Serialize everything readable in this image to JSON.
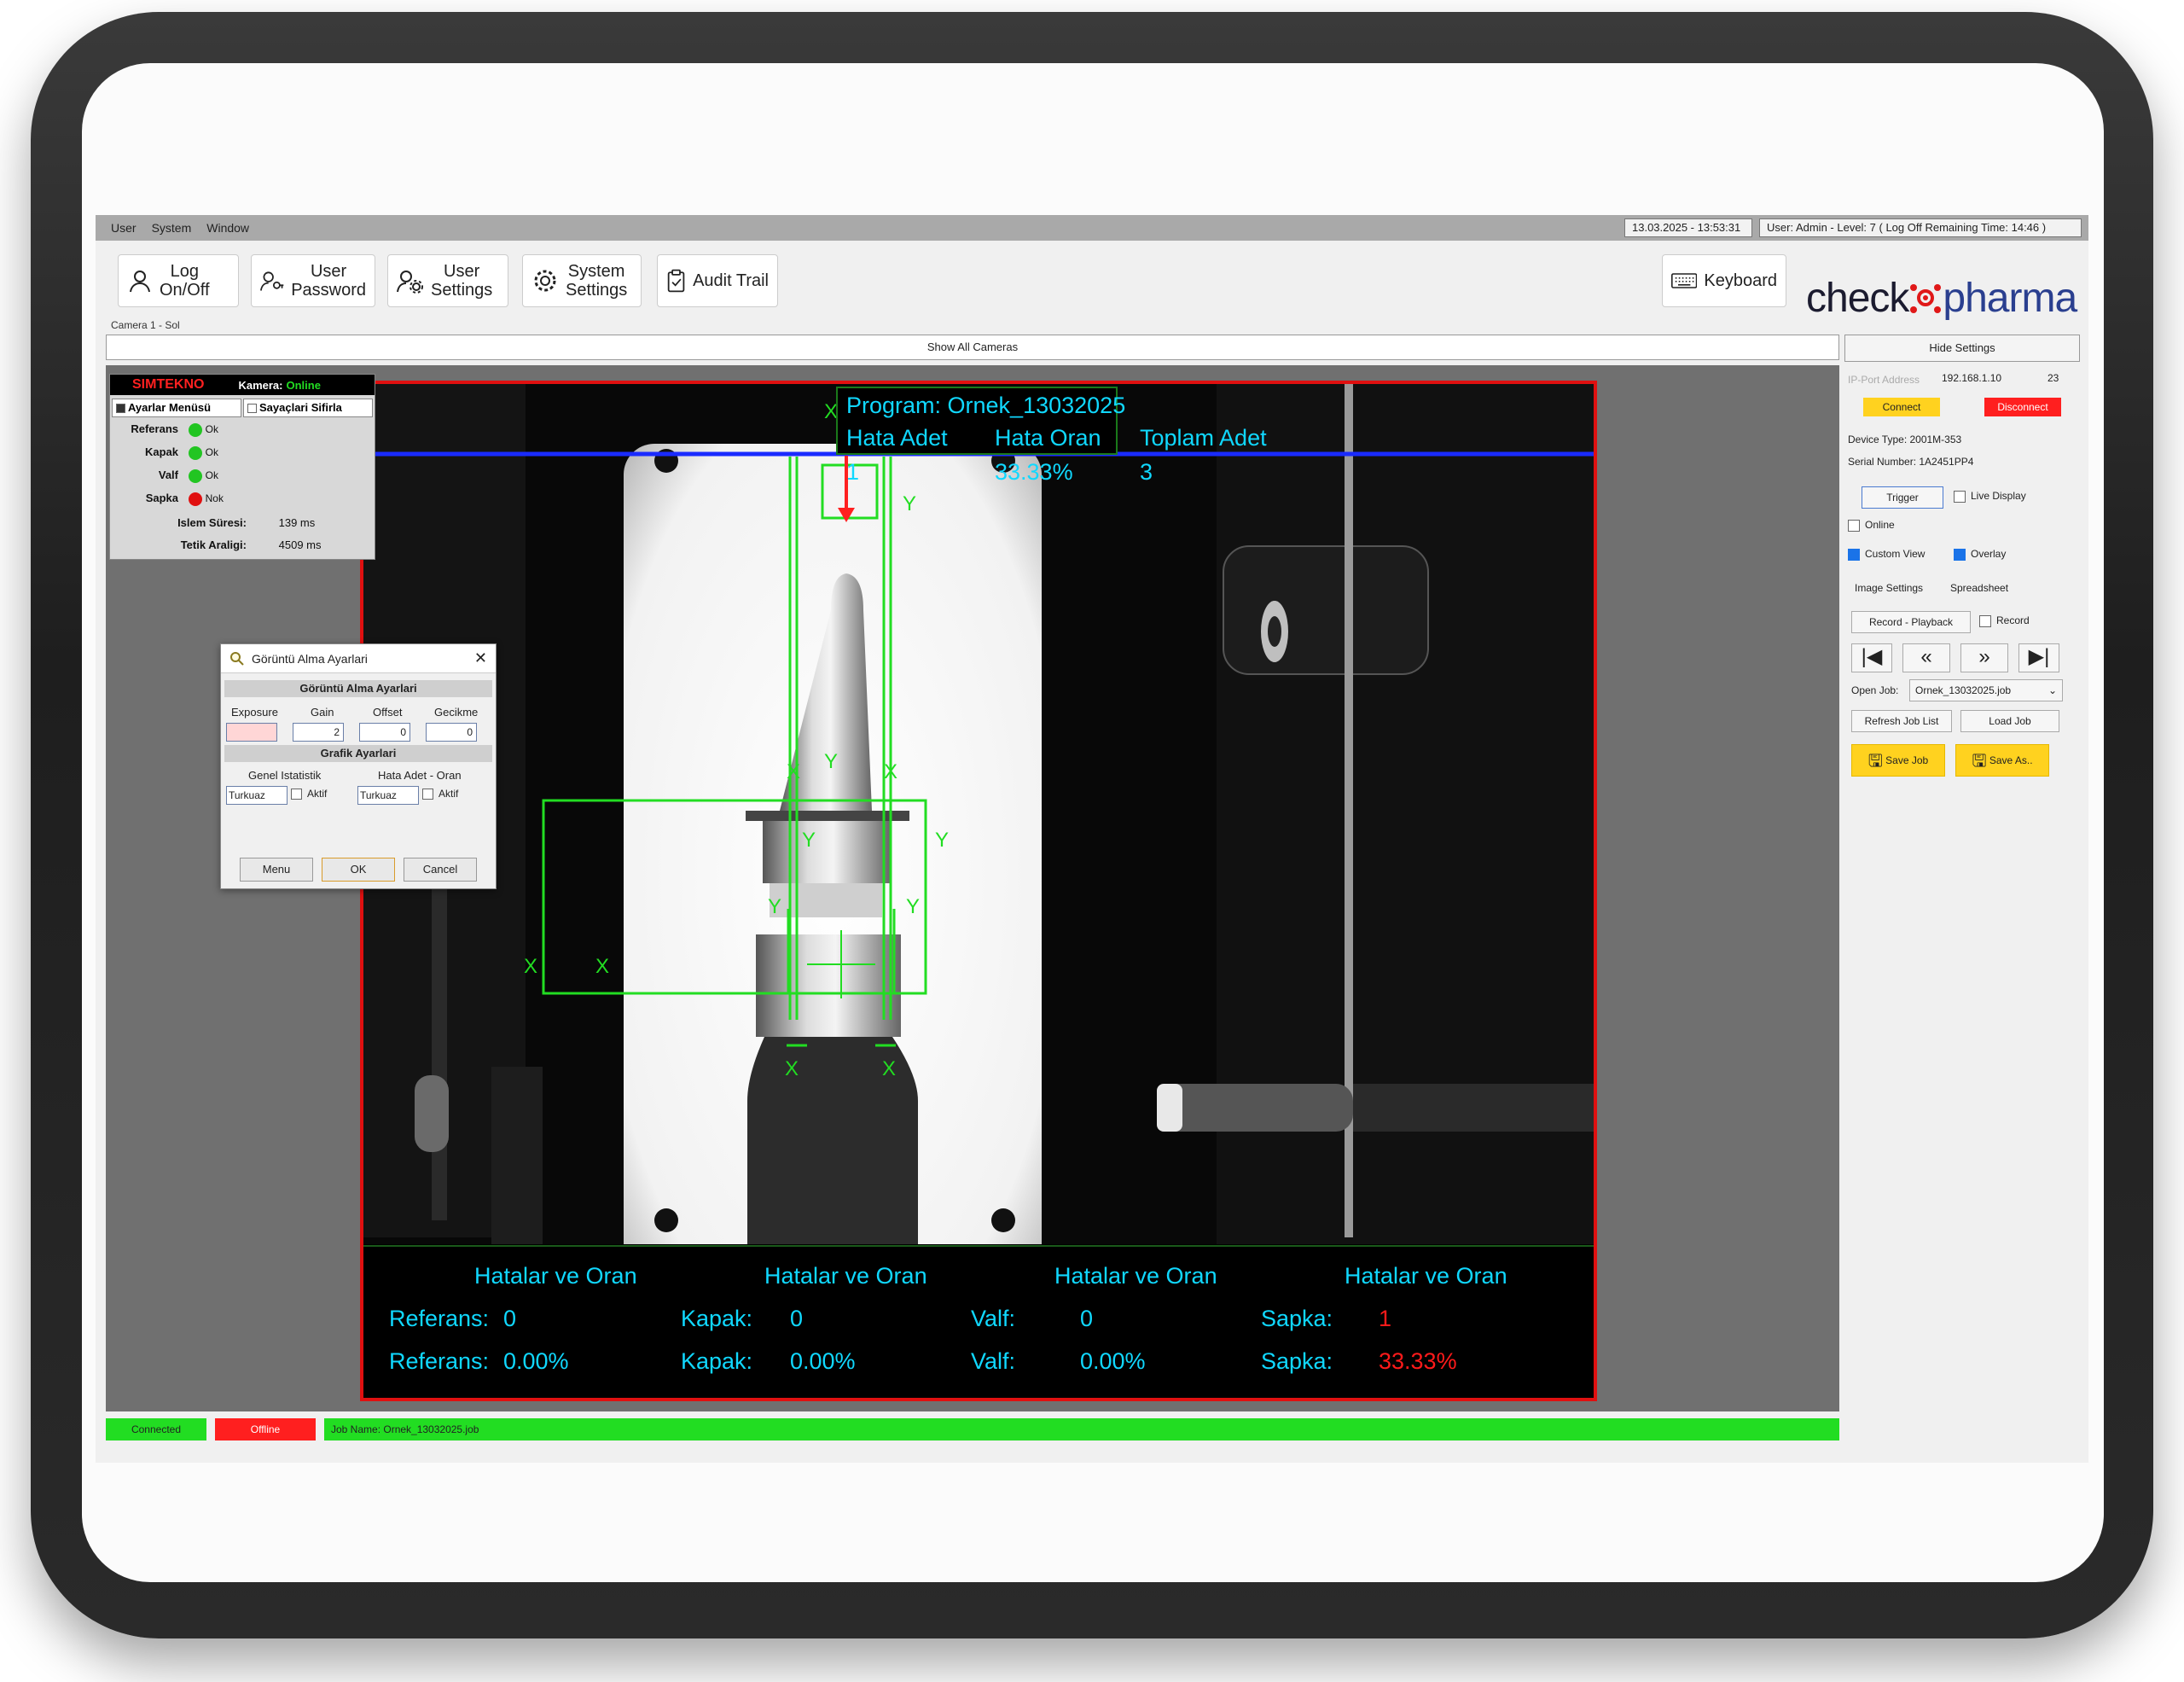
{
  "menu": [
    "User",
    "System",
    "Window"
  ],
  "datetime": "13.03.2025 - 13:53:31",
  "user_status": "User: Admin - Level: 7   ( Log Off Remaining Time: 14:46 )",
  "toolbar": {
    "log_onoff": "Log\nOn/Off",
    "user_password": "User\nPassword",
    "user_settings": "User\nSettings",
    "system_settings": "System\nSettings",
    "audit_trail": "Audit Trail",
    "keyboard": "Keyboard"
  },
  "logo": {
    "part1": "check",
    "part2": "pharma"
  },
  "camera_label": "Camera 1 - Sol",
  "show_all": "Show All Cameras",
  "hide_settings": "Hide Settings",
  "sim": {
    "brand": "SIMTEKNO",
    "camera_label": "Kamera:",
    "camera_status": "Online",
    "menu_btn": "Ayarlar Menüsü",
    "reset_btn": "Sayaçlari Sifirla",
    "rows": [
      {
        "label": "Referans",
        "status": "Ok",
        "color": "#22c522"
      },
      {
        "label": "Kapak",
        "status": "Ok",
        "color": "#22c522"
      },
      {
        "label": "Valf",
        "status": "Ok",
        "color": "#22c522"
      },
      {
        "label": "Sapka",
        "status": "Nok",
        "color": "#e01010"
      }
    ],
    "process_label": "Islem Süresi:",
    "process_value": "139 ms",
    "trigger_label": "Tetik Araligi:",
    "trigger_value": "4509 ms"
  },
  "dialog": {
    "title": "Görüntü Alma Ayarlari",
    "section1": "Görüntü Alma Ayarlari",
    "cols": [
      "Exposure",
      "Gain",
      "Offset",
      "Gecikme"
    ],
    "gain": "2",
    "offset": "0",
    "delay": "0",
    "section2": "Grafik Ayarlari",
    "genel": "Genel Istatistik",
    "hata": "Hata Adet - Oran",
    "color1": "Turkuaz",
    "color2": "Turkuaz",
    "aktif": "Aktif",
    "btn_menu": "Menu",
    "btn_ok": "OK",
    "btn_cancel": "Cancel"
  },
  "overlay": {
    "program": "Program: Ornek_13032025",
    "hata_adet_label": "Hata Adet",
    "hata_oran_label": "Hata Oran",
    "toplam_label": "Toplam Adet",
    "hata_adet": "1",
    "hata_oran": "33.33%",
    "toplam": "3",
    "group_title": "Hatalar ve Oran",
    "ref_label": "Referans:",
    "kapak_label": "Kapak:",
    "valf_label": "Valf:",
    "sapka_label": "Sapka:",
    "ref_count": "0",
    "kapak_count": "0",
    "valf_count": "0",
    "sapka_count": "1",
    "ref_pct": "0.00%",
    "kapak_pct": "0.00%",
    "valf_pct": "0.00%",
    "sapka_pct": "33.33%"
  },
  "right_panel": {
    "ip_label": "IP-Port Address",
    "ip": "192.168.1.10",
    "port": "23",
    "connect": "Connect",
    "disconnect": "Disconnect",
    "device_type": "Device Type: 2001M-353",
    "serial": "Serial Number: 1A2451PP4",
    "trigger": "Trigger",
    "live_display": "Live Display",
    "online": "Online",
    "custom_view": "Custom View",
    "overlay": "Overlay",
    "image_settings": "Image Settings",
    "spreadsheet": "Spreadsheet",
    "record_playback": "Record - Playback",
    "record": "Record",
    "open_job_label": "Open Job:",
    "open_job": "Ornek_13032025.job",
    "refresh": "Refresh Job List",
    "load_job": "Load Job",
    "save_job": "Save Job",
    "save_as": "Save As.."
  },
  "status": {
    "connected": "Connected",
    "offline": "Offline",
    "job": "Job Name: Ornek_13032025.job"
  },
  "colors": {
    "accent_red": "#e01010",
    "accent_green": "#22dd22",
    "overlay_cyan": "#10d8ff",
    "save_yellow": "#ffd21f"
  }
}
